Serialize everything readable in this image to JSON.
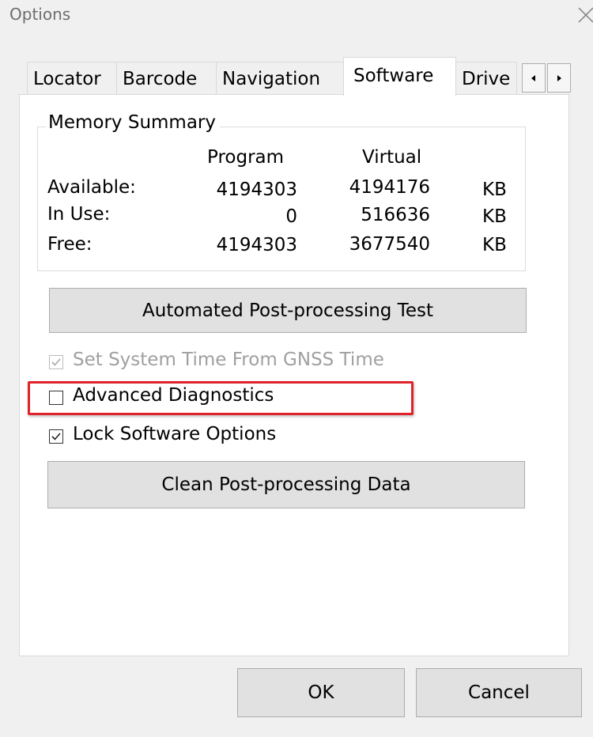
{
  "window": {
    "title": "Options"
  },
  "tabs": [
    {
      "label": "Locator"
    },
    {
      "label": "Barcode"
    },
    {
      "label": "Navigation"
    },
    {
      "label": "Software",
      "active": true
    },
    {
      "label": "Drive"
    }
  ],
  "memory_summary": {
    "title": "Memory Summary",
    "headers": {
      "program": "Program",
      "virtual": "Virtual"
    },
    "rows": [
      {
        "label": "Available:",
        "program": "4194303",
        "virtual": "4194176",
        "unit": "KB"
      },
      {
        "label": "In Use:",
        "program": "0",
        "virtual": "516636",
        "unit": "KB"
      },
      {
        "label": "Free:",
        "program": "4194303",
        "virtual": "3677540",
        "unit": "KB"
      }
    ]
  },
  "buttons": {
    "automated_test": "Automated Post-processing Test",
    "clean_data": "Clean Post-processing Data",
    "ok": "OK",
    "cancel": "Cancel"
  },
  "checkboxes": {
    "gnss_time": {
      "label": "Set System Time From GNSS Time",
      "checked": true,
      "enabled": false
    },
    "advanced_diagnostics": {
      "label": "Advanced Diagnostics",
      "checked": false,
      "enabled": true
    },
    "lock_options": {
      "label": "Lock Software Options",
      "checked": true,
      "enabled": true
    }
  },
  "colors": {
    "highlight": "#e0222a",
    "panel": "#ffffff",
    "window": "#f0f0f0"
  }
}
